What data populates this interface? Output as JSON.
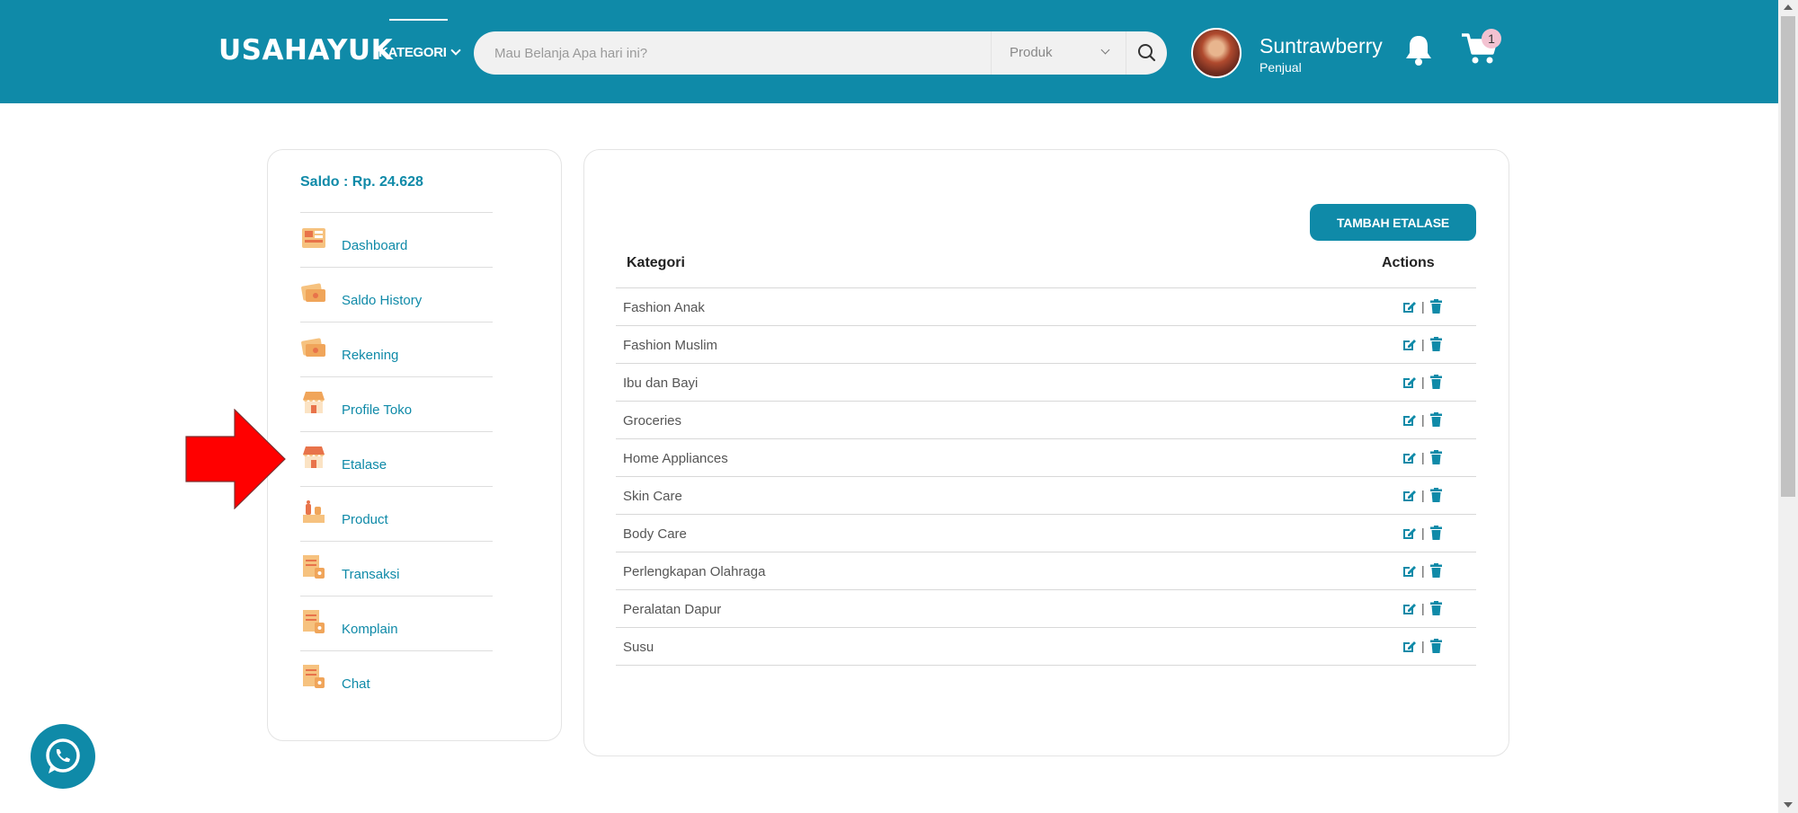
{
  "header": {
    "logo": "USAHAYUK",
    "kategori_label": "KATEGORI",
    "search_placeholder": "Mau Belanja Apa hari ini?",
    "search_scope": "Produk",
    "user_name": "Suntrawberry",
    "user_role": "Penjual",
    "cart_count": "1"
  },
  "sidebar": {
    "saldo": "Saldo : Rp. 24.628",
    "items": [
      {
        "label": "Dashboard",
        "icon": "dashboard-icon"
      },
      {
        "label": "Saldo History",
        "icon": "saldo-history-icon"
      },
      {
        "label": "Rekening",
        "icon": "rekening-icon"
      },
      {
        "label": "Profile Toko",
        "icon": "store-icon"
      },
      {
        "label": "Etalase",
        "icon": "store-icon"
      },
      {
        "label": "Product",
        "icon": "product-icon"
      },
      {
        "label": "Transaksi",
        "icon": "document-icon"
      },
      {
        "label": "Komplain",
        "icon": "document-icon"
      },
      {
        "label": "Chat",
        "icon": "document-icon"
      }
    ]
  },
  "main": {
    "add_button": "TAMBAH ETALASE",
    "columns": [
      "Kategori",
      "Actions"
    ],
    "rows": [
      "Fashion Anak",
      "Fashion Muslim",
      "Ibu dan Bayi",
      "Groceries",
      "Home Appliances",
      "Skin Care",
      "Body Care",
      "Perlengkapan Olahraga",
      "Peralatan Dapur",
      "Susu"
    ],
    "action_separator": "|"
  },
  "colors": {
    "brand": "#0f8aa8",
    "annotation_arrow": "#ff0000",
    "icon_orange": "#f0a55a"
  }
}
